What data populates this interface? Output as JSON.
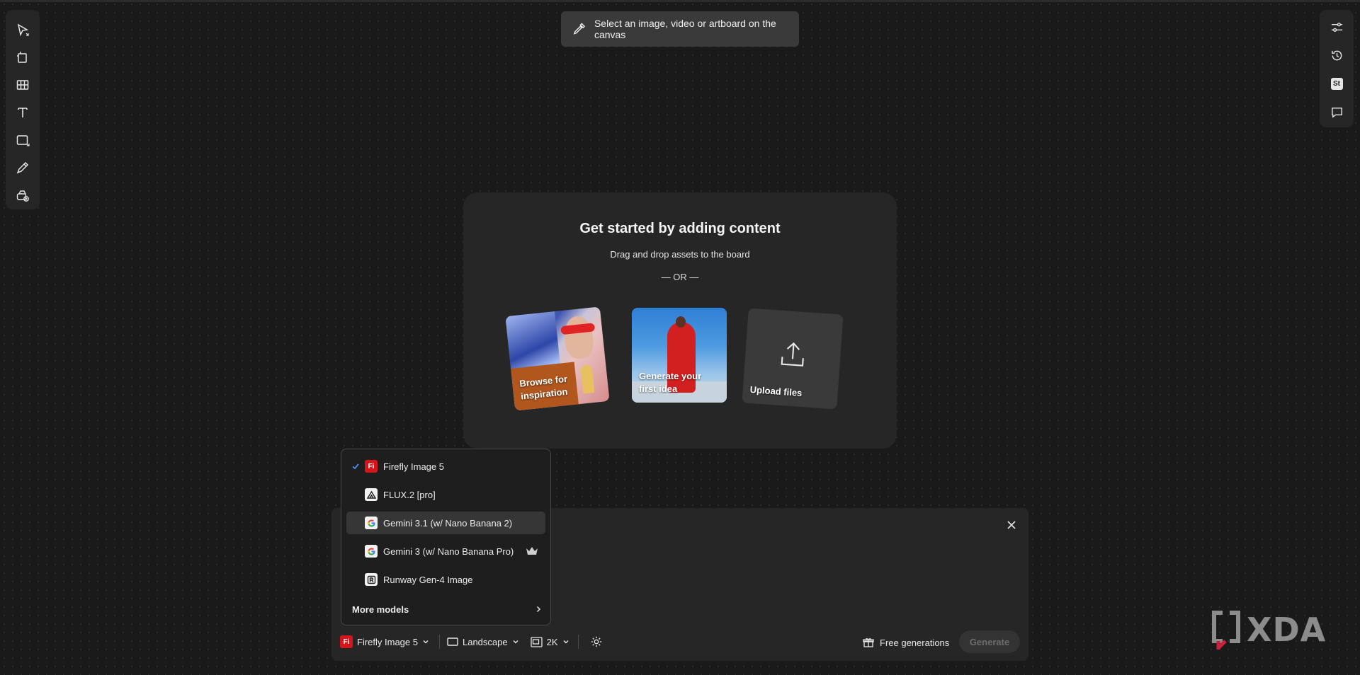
{
  "colors": {
    "canvas_bg": "#1a1a1a",
    "panel_bg": "#262626",
    "firefly_red": "#d6141b",
    "check_blue": "#4b8df8"
  },
  "left_toolbar": {
    "tools": [
      "select-icon",
      "artboard-icon",
      "grid-icon",
      "text-icon",
      "rectangle-icon",
      "pen-icon",
      "generate-icon"
    ]
  },
  "right_toolbar": {
    "tools": [
      "adjust-icon",
      "history-icon",
      "stock-icon",
      "comment-icon"
    ],
    "stock_badge": "St"
  },
  "hint": {
    "text": "Select an image, video or artboard on the canvas"
  },
  "center_card": {
    "title": "Get started by adding content",
    "subtitle": "Drag and drop assets to the board",
    "or": "— OR —",
    "tiles": {
      "browse_line1": "Browse for",
      "browse_line2": "inspiration",
      "generate_line1": "Generate your",
      "generate_line2": "first idea",
      "upload": "Upload files"
    }
  },
  "model_menu": {
    "items": [
      {
        "label": "Firefly Image 5",
        "icon": "Fi",
        "selected": true
      },
      {
        "label": "FLUX.2 [pro]",
        "icon": "flux-icon"
      },
      {
        "label": "Gemini 3.1 (w/ Nano Banana 2)",
        "icon": "google-icon",
        "highlighted": true
      },
      {
        "label": "Gemini 3 (w/ Nano Banana Pro)",
        "icon": "google-icon",
        "premium": true
      },
      {
        "label": "Runway Gen-4 Image",
        "icon": "runway-icon"
      }
    ],
    "more": "More models"
  },
  "bottom_bar": {
    "model_badge": "Fi",
    "model": "Firefly Image 5",
    "aspect": "Landscape",
    "resolution": "2K",
    "free_generations": "Free generations",
    "generate": "Generate"
  },
  "watermark": "XDA"
}
